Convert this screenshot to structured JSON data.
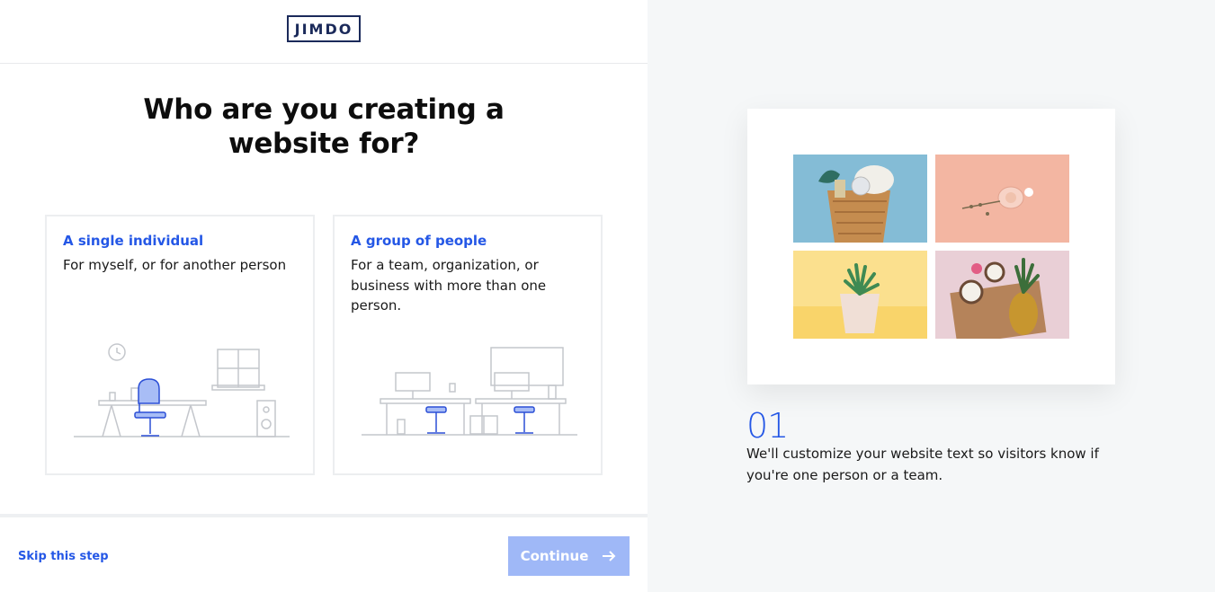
{
  "header": {
    "logo_text": "JIMDO"
  },
  "main": {
    "title": "Who are you creating a website for?",
    "cards": [
      {
        "title": "A single individual",
        "description": "For myself, or for another person"
      },
      {
        "title": "A group of people",
        "description": "For a team, organization, or business with more than one person."
      }
    ]
  },
  "footer": {
    "skip_label": "Skip this step",
    "continue_label": "Continue"
  },
  "preview": {
    "step_number": "01",
    "step_text": "We'll customize your website text so visitors know if you're one person or a team."
  },
  "colors": {
    "accent": "#2457e6",
    "button_disabled": "#9fb8f7",
    "panel_bg": "#f5f7f8",
    "logo": "#1b2a5a"
  }
}
